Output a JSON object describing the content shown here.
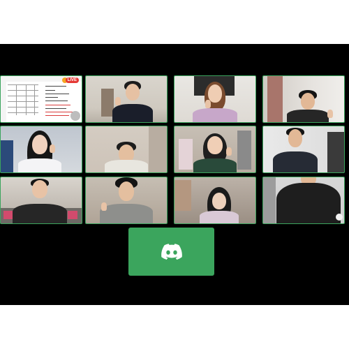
{
  "call": {
    "background": "#000000",
    "tile_border": "#3ba55d",
    "participants": [
      {
        "kind": "screen-share"
      },
      {
        "kind": "camera"
      },
      {
        "kind": "camera"
      },
      {
        "kind": "camera"
      },
      {
        "kind": "camera"
      },
      {
        "kind": "camera"
      },
      {
        "kind": "camera"
      },
      {
        "kind": "camera"
      },
      {
        "kind": "camera"
      },
      {
        "kind": "camera"
      },
      {
        "kind": "camera"
      },
      {
        "kind": "camera"
      }
    ]
  },
  "screen_share": {
    "live_badge": "LIVE"
  },
  "discord_button": {
    "icon": "discord-logo-icon",
    "color": "#3ba55d"
  }
}
